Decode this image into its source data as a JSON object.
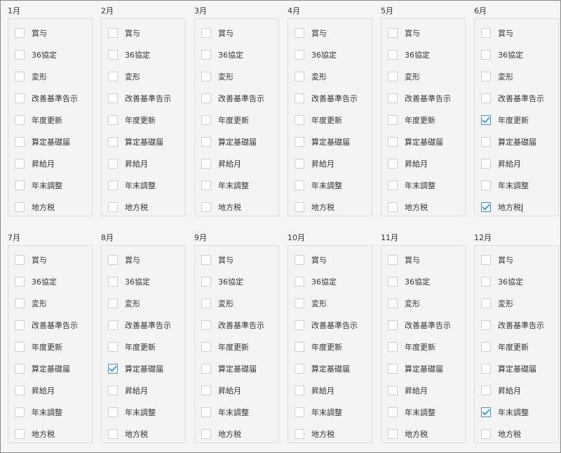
{
  "months": [
    {
      "title": "1月",
      "items": [
        {
          "label": "賞与",
          "checked": false
        },
        {
          "label": "36協定",
          "checked": false
        },
        {
          "label": "変形",
          "checked": false
        },
        {
          "label": "改善基準告示",
          "checked": false
        },
        {
          "label": "年度更新",
          "checked": false
        },
        {
          "label": "算定基礎届",
          "checked": false
        },
        {
          "label": "昇給月",
          "checked": false
        },
        {
          "label": "年末調整",
          "checked": false
        },
        {
          "label": "地方税",
          "checked": false
        }
      ]
    },
    {
      "title": "2月",
      "items": [
        {
          "label": "賞与",
          "checked": false
        },
        {
          "label": "36協定",
          "checked": false
        },
        {
          "label": "変形",
          "checked": false
        },
        {
          "label": "改善基準告示",
          "checked": false
        },
        {
          "label": "年度更新",
          "checked": false
        },
        {
          "label": "算定基礎届",
          "checked": false
        },
        {
          "label": "昇給月",
          "checked": false
        },
        {
          "label": "年末調整",
          "checked": false
        },
        {
          "label": "地方税",
          "checked": false
        }
      ]
    },
    {
      "title": "3月",
      "items": [
        {
          "label": "賞与",
          "checked": false
        },
        {
          "label": "36協定",
          "checked": false
        },
        {
          "label": "変形",
          "checked": false
        },
        {
          "label": "改善基準告示",
          "checked": false
        },
        {
          "label": "年度更新",
          "checked": false
        },
        {
          "label": "算定基礎届",
          "checked": false
        },
        {
          "label": "昇給月",
          "checked": false
        },
        {
          "label": "年末調整",
          "checked": false
        },
        {
          "label": "地方税",
          "checked": false
        }
      ]
    },
    {
      "title": "4月",
      "items": [
        {
          "label": "賞与",
          "checked": false
        },
        {
          "label": "36協定",
          "checked": false
        },
        {
          "label": "変形",
          "checked": false
        },
        {
          "label": "改善基準告示",
          "checked": false
        },
        {
          "label": "年度更新",
          "checked": false
        },
        {
          "label": "算定基礎届",
          "checked": false
        },
        {
          "label": "昇給月",
          "checked": false
        },
        {
          "label": "年末調整",
          "checked": false
        },
        {
          "label": "地方税",
          "checked": false
        }
      ]
    },
    {
      "title": "5月",
      "items": [
        {
          "label": "賞与",
          "checked": false
        },
        {
          "label": "36協定",
          "checked": false
        },
        {
          "label": "変形",
          "checked": false
        },
        {
          "label": "改善基準告示",
          "checked": false
        },
        {
          "label": "年度更新",
          "checked": false
        },
        {
          "label": "算定基礎届",
          "checked": false
        },
        {
          "label": "昇給月",
          "checked": false
        },
        {
          "label": "年末調整",
          "checked": false
        },
        {
          "label": "地方税",
          "checked": false
        }
      ]
    },
    {
      "title": "6月",
      "items": [
        {
          "label": "賞与",
          "checked": false
        },
        {
          "label": "36協定",
          "checked": false
        },
        {
          "label": "変形",
          "checked": false
        },
        {
          "label": "改善基準告示",
          "checked": false
        },
        {
          "label": "年度更新",
          "checked": true
        },
        {
          "label": "算定基礎届",
          "checked": false
        },
        {
          "label": "昇給月",
          "checked": false
        },
        {
          "label": "年末調整",
          "checked": false
        },
        {
          "label": "地方税",
          "checked": true,
          "caret": true
        }
      ]
    },
    {
      "title": "7月",
      "items": [
        {
          "label": "賞与",
          "checked": false
        },
        {
          "label": "36協定",
          "checked": false
        },
        {
          "label": "変形",
          "checked": false
        },
        {
          "label": "改善基準告示",
          "checked": false
        },
        {
          "label": "年度更新",
          "checked": false
        },
        {
          "label": "算定基礎届",
          "checked": false
        },
        {
          "label": "昇給月",
          "checked": false
        },
        {
          "label": "年末調整",
          "checked": false
        },
        {
          "label": "地方税",
          "checked": false
        }
      ]
    },
    {
      "title": "8月",
      "items": [
        {
          "label": "賞与",
          "checked": false
        },
        {
          "label": "36協定",
          "checked": false
        },
        {
          "label": "変形",
          "checked": false
        },
        {
          "label": "改善基準告示",
          "checked": false
        },
        {
          "label": "年度更新",
          "checked": false
        },
        {
          "label": "算定基礎届",
          "checked": true
        },
        {
          "label": "昇給月",
          "checked": false
        },
        {
          "label": "年末調整",
          "checked": false
        },
        {
          "label": "地方税",
          "checked": false
        }
      ]
    },
    {
      "title": "9月",
      "items": [
        {
          "label": "賞与",
          "checked": false
        },
        {
          "label": "36協定",
          "checked": false
        },
        {
          "label": "変形",
          "checked": false
        },
        {
          "label": "改善基準告示",
          "checked": false
        },
        {
          "label": "年度更新",
          "checked": false
        },
        {
          "label": "算定基礎届",
          "checked": false
        },
        {
          "label": "昇給月",
          "checked": false
        },
        {
          "label": "年末調整",
          "checked": false
        },
        {
          "label": "地方税",
          "checked": false
        }
      ]
    },
    {
      "title": "10月",
      "items": [
        {
          "label": "賞与",
          "checked": false
        },
        {
          "label": "36協定",
          "checked": false
        },
        {
          "label": "変形",
          "checked": false
        },
        {
          "label": "改善基準告示",
          "checked": false
        },
        {
          "label": "年度更新",
          "checked": false
        },
        {
          "label": "算定基礎届",
          "checked": false
        },
        {
          "label": "昇給月",
          "checked": false
        },
        {
          "label": "年末調整",
          "checked": false
        },
        {
          "label": "地方税",
          "checked": false
        }
      ]
    },
    {
      "title": "11月",
      "items": [
        {
          "label": "賞与",
          "checked": false
        },
        {
          "label": "36協定",
          "checked": false
        },
        {
          "label": "変形",
          "checked": false
        },
        {
          "label": "改善基準告示",
          "checked": false
        },
        {
          "label": "年度更新",
          "checked": false
        },
        {
          "label": "算定基礎届",
          "checked": false
        },
        {
          "label": "昇給月",
          "checked": false
        },
        {
          "label": "年末調整",
          "checked": false
        },
        {
          "label": "地方税",
          "checked": false
        }
      ]
    },
    {
      "title": "12月",
      "items": [
        {
          "label": "賞与",
          "checked": false
        },
        {
          "label": "36協定",
          "checked": false
        },
        {
          "label": "変形",
          "checked": false
        },
        {
          "label": "改善基準告示",
          "checked": false
        },
        {
          "label": "年度更新",
          "checked": false
        },
        {
          "label": "算定基礎届",
          "checked": false
        },
        {
          "label": "昇給月",
          "checked": false
        },
        {
          "label": "年末調整",
          "checked": true
        },
        {
          "label": "地方税",
          "checked": false
        }
      ]
    }
  ],
  "colors": {
    "checkbox_checked_border": "#3f8fd6",
    "checkmark": "#3f8fd6",
    "checkbox_border": "#cfcfcf"
  }
}
